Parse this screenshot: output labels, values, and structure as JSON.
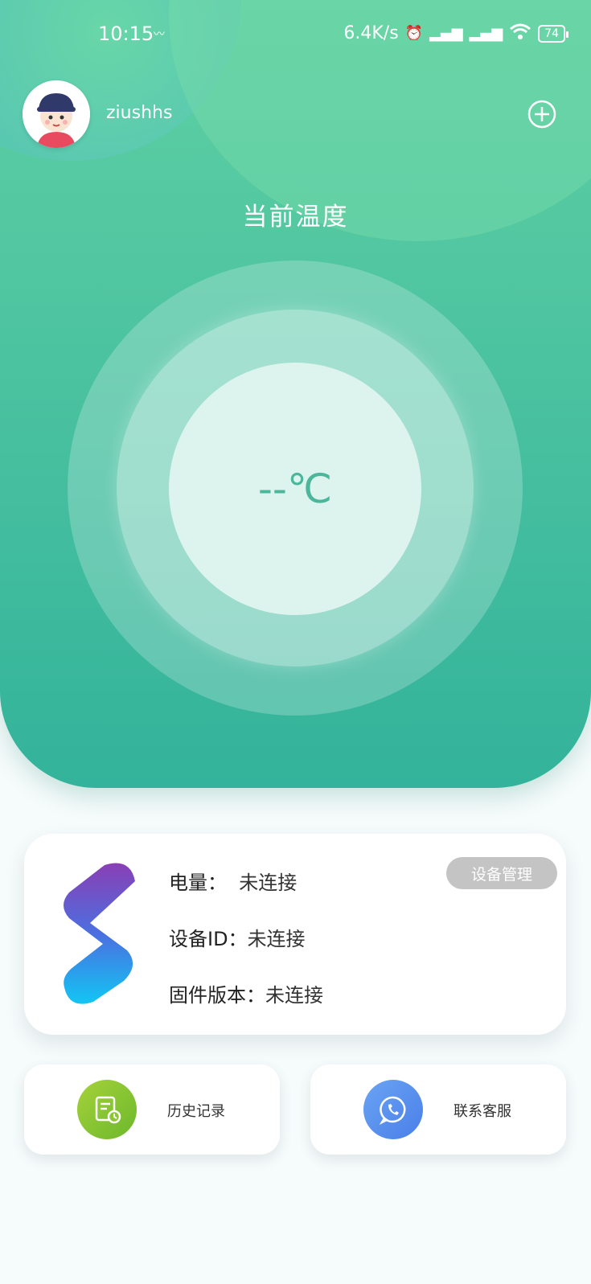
{
  "status_bar": {
    "time": "10:15",
    "network_speed": "6.4K/s",
    "battery": "74",
    "icons": [
      "notification-icon",
      "alarm-icon",
      "signal-hd-icon",
      "signal-hd-icon",
      "wifi-icon",
      "battery-icon"
    ]
  },
  "header": {
    "username": "ziushhs",
    "add_icon": "plus-circle-icon"
  },
  "main": {
    "title": "当前温度",
    "temperature": "--℃"
  },
  "device": {
    "manage_label": "设备管理",
    "battery_label": "电量：",
    "battery_value": "未连接",
    "id_label": "设备ID：",
    "id_value": "未连接",
    "firmware_label": "固件版本：",
    "firmware_value": "未连接"
  },
  "actions": {
    "history_label": "历史记录",
    "support_label": "联系客服"
  },
  "colors": {
    "hero_top": "#5fd0a3",
    "hero_bottom": "#33b39b",
    "temperature_text": "#4bb79a",
    "history_icon_bg": "#8bc733",
    "support_icon_bg": "#5b93f0",
    "manage_button_bg": "#c4c4c4"
  }
}
